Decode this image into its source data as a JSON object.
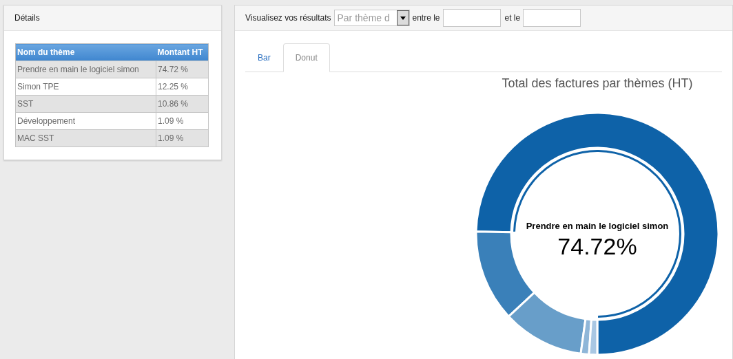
{
  "details": {
    "title": "Détails",
    "table": {
      "columns": [
        "Nom du thème",
        "Montant HT"
      ],
      "rows": [
        [
          "Prendre en main le logiciel simon",
          "74.72 %"
        ],
        [
          "Simon TPE",
          "12.25 %"
        ],
        [
          "SST",
          "10.86 %"
        ],
        [
          "Développement",
          "1.09 %"
        ],
        [
          "MAC SST",
          "1.09 %"
        ]
      ]
    }
  },
  "filter": {
    "label": "Visualisez vos résultats",
    "select_value": "Par thème d",
    "between_label": "entre le",
    "and_label": "et le"
  },
  "tabs": [
    {
      "label": "Bar",
      "selected": false
    },
    {
      "label": "Donut",
      "selected": true
    }
  ],
  "chart": {
    "center_label": "Prendre en main le logiciel simon",
    "center_value": "74.72%",
    "chart_data": {
      "type": "donut",
      "title": "Total des factures par thèmes (HT)",
      "series": [
        {
          "values": [
            74.72,
            12.25,
            10.86,
            1.09,
            1.09
          ]
        }
      ]
    }
  }
}
